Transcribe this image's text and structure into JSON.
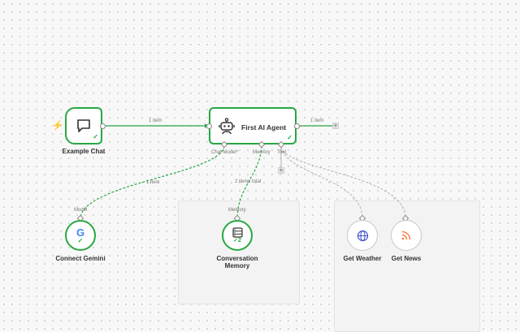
{
  "nodes": {
    "chat": {
      "label": "Example Chat"
    },
    "agent": {
      "label": "First AI Agent",
      "inputs": {
        "chat_model": "Chat Model*",
        "memory": "Memory",
        "tool": "Tool"
      }
    },
    "gemini": {
      "label": "Connect Gemini",
      "port_label": "Model"
    },
    "memory": {
      "label_line1": "Conversation",
      "label_line2": "Memory",
      "port_label": "Memory",
      "run_count": "2"
    },
    "weather": {
      "label": "Get Weather"
    },
    "news": {
      "label": "Get News"
    }
  },
  "edges": {
    "chat_to_agent": "1 item",
    "agent_out": "1 item",
    "model_link": "1 item",
    "memory_link": "2 items total"
  },
  "colors": {
    "success": "#27a844",
    "dashed_active": "#27a844",
    "dashed_idle": "#b5b5b5",
    "trigger": "#ff6d2d"
  },
  "icons": {
    "trigger": "lightning-icon",
    "chat": "chat-bubble-icon",
    "agent": "robot-icon",
    "gemini": "google-g-icon",
    "memory": "database-icon",
    "weather": "globe-icon",
    "news": "rss-icon",
    "add": "plus-icon",
    "success": "checkmark-icon"
  }
}
